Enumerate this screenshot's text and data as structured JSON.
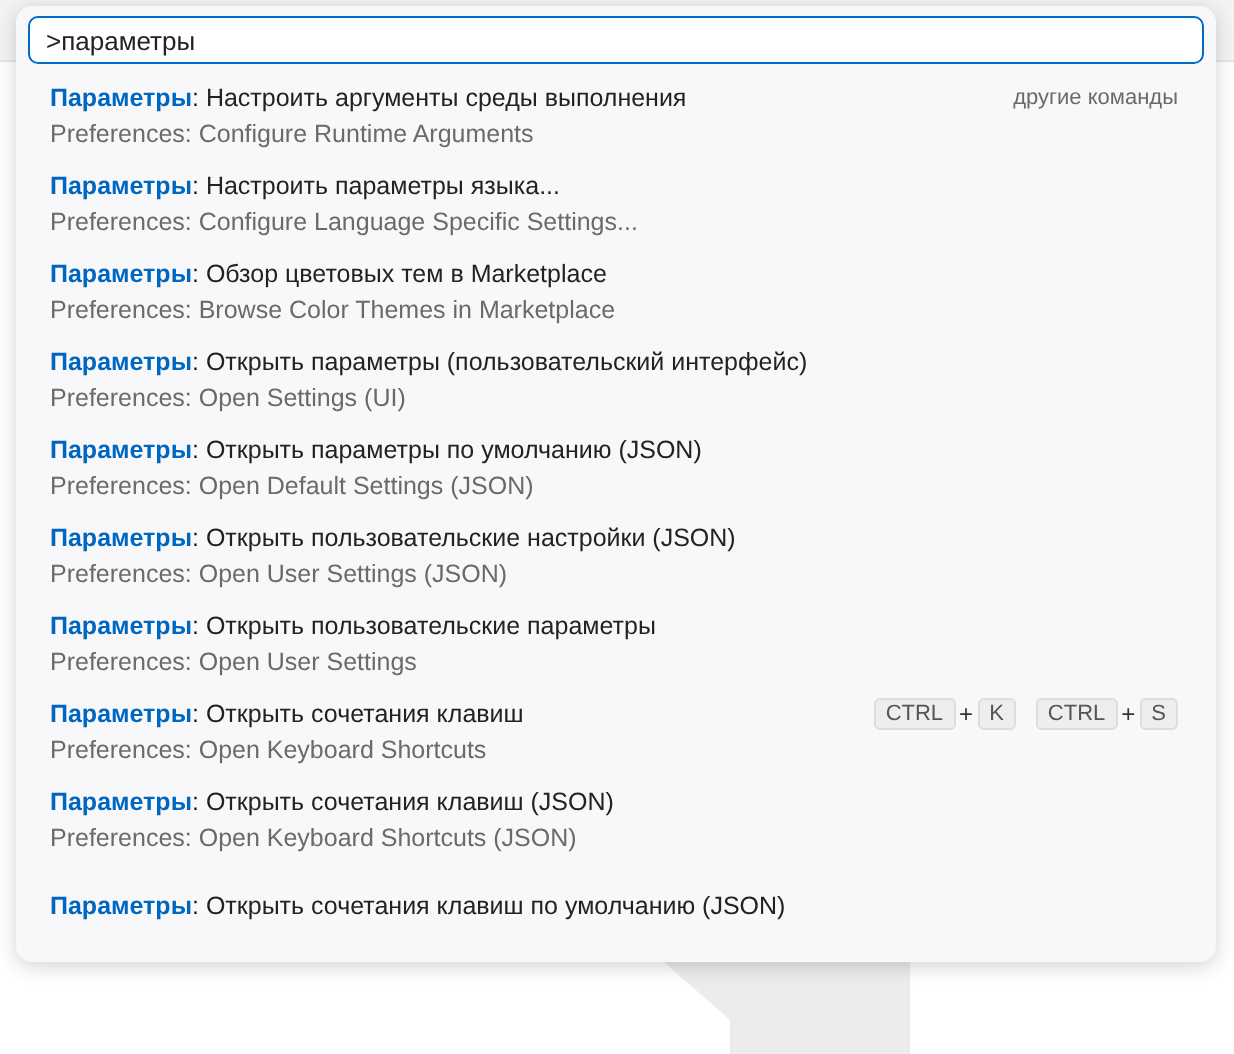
{
  "quick_open": {
    "value": ">параметры",
    "items": [
      {
        "label": "**Параметры**: Настроить аргументы среды выполнения",
        "detail": "Preferences: Configure Runtime Arguments",
        "aside": "другие команды"
      },
      {
        "label": "**Параметры**: Настроить параметры языка...",
        "detail": "Preferences: Configure Language Specific Settings..."
      },
      {
        "label": "**Параметры**: Обзор цветовых тем в Marketplace",
        "detail": "Preferences: Browse Color Themes in Marketplace"
      },
      {
        "label": "**Параметры**: Открыть параметры (пользовательский интерфейс)",
        "detail": "Preferences: Open Settings (UI)"
      },
      {
        "label": "**Параметры**: Открыть параметры по умолчанию (JSON)",
        "detail": "Preferences: Open Default Settings (JSON)"
      },
      {
        "label": "**Параметры**: Открыть пользовательские настройки (JSON)",
        "detail": "Preferences: Open User Settings (JSON)"
      },
      {
        "label": "**Параметры**: Открыть пользовательские параметры",
        "detail": "Preferences: Open User Settings"
      },
      {
        "label": "**Параметры**: Открыть сочетания клавиш",
        "detail": "Preferences: Open Keyboard Shortcuts",
        "chords": [
          [
            {
              "kind": "key",
              "text": "CTRL"
            },
            {
              "kind": "plus",
              "text": "+"
            },
            {
              "kind": "key",
              "text": "K"
            }
          ],
          [
            {
              "kind": "key",
              "text": "CTRL"
            },
            {
              "kind": "plus",
              "text": "+"
            },
            {
              "kind": "key",
              "text": "S"
            }
          ]
        ]
      },
      {
        "label": "**Параметры**: Открыть сочетания клавиш (JSON)",
        "detail": "Preferences: Open Keyboard Shortcuts (JSON)"
      },
      {
        "label": "**Параметры**: Открыть сочетания клавиш по умолчанию (JSON)"
      }
    ]
  }
}
